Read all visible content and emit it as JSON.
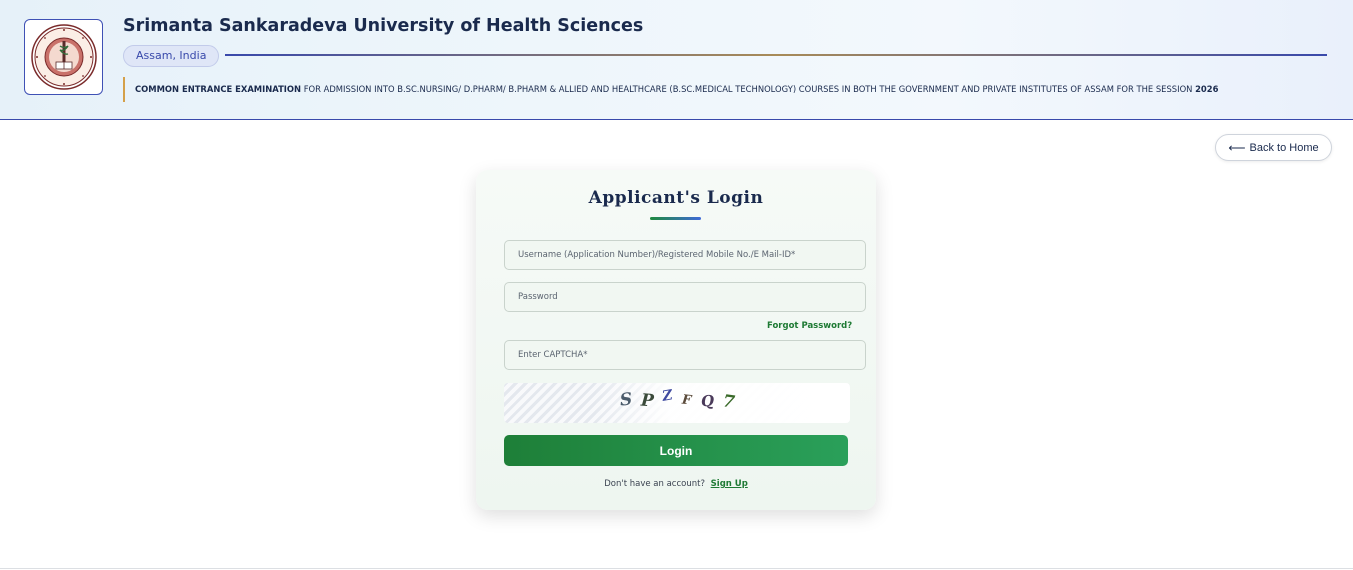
{
  "header": {
    "university_name": "Srimanta Sankaradeva University of Health Sciences",
    "location_badge": "Assam, India",
    "exam_title_bold": "COMMON ENTRANCE EXAMINATION",
    "exam_description": " FOR ADMISSION INTO B.SC.NURSING/ D.PHARM/ B.PHARM & ALLIED AND HEALTHCARE (B.SC.MEDICAL TECHNOLOGY) COURSES IN BOTH THE GOVERNMENT AND PRIVATE INSTITUTES OF ASSAM FOR THE SESSION ",
    "session_year": "2026",
    "logo_icon": "university-seal-icon"
  },
  "nav": {
    "back_arrow": "⟵",
    "back_label": "Back to Home"
  },
  "login": {
    "title": "Applicant's Login",
    "username_placeholder": "Username (Application Number)/Registered Mobile No./E Mail-ID*",
    "password_placeholder": "Password",
    "forgot_password": "Forgot Password?",
    "captcha_placeholder": "Enter CAPTCHA*",
    "captcha_chars": [
      "S",
      "P",
      "Z",
      "F",
      "Q",
      "7"
    ],
    "login_button": "Login",
    "no_account_text": "Don't have an account?",
    "signup_link": "Sign Up"
  },
  "colors": {
    "primary_green": "#1e7f38",
    "brand_navy": "#1a2a4d",
    "accent_indigo": "#3949ab",
    "accent_gold": "#d4a04a"
  }
}
